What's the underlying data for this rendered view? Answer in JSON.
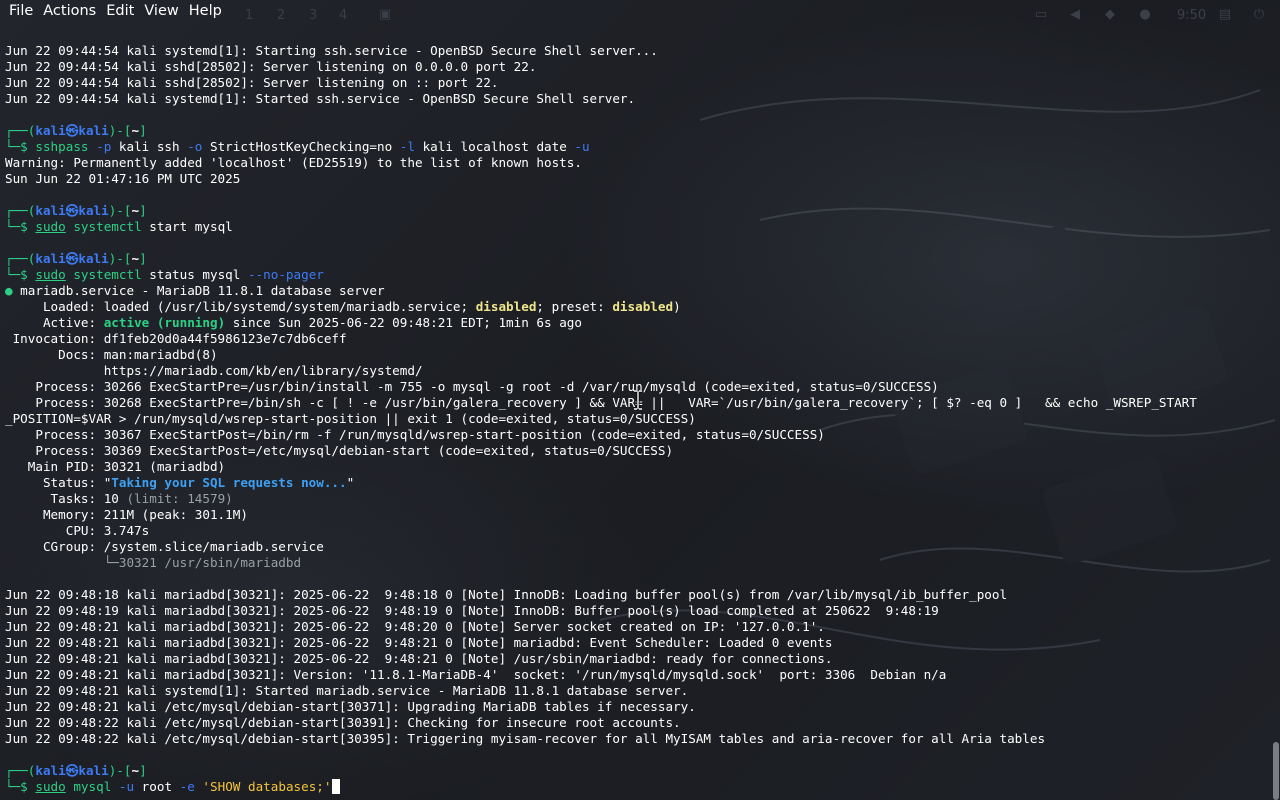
{
  "menubar": {
    "items": [
      "File",
      "Actions",
      "Edit",
      "View",
      "Help"
    ]
  },
  "panel": {
    "workspaces": [
      "1",
      "2",
      "3",
      "4"
    ],
    "clock": "9:50"
  },
  "terminal": {
    "lines": [
      [
        {
          "t": "Jun 22 09:44:54 kali systemd[1]: Starting ssh.service - OpenBSD Secure Shell server..."
        }
      ],
      [
        {
          "t": "Jun 22 09:44:54 kali sshd[28502]: Server listening on 0.0.0.0 port 22."
        }
      ],
      [
        {
          "t": "Jun 22 09:44:54 kali sshd[28502]: Server listening on :: port 22."
        }
      ],
      [
        {
          "t": "Jun 22 09:44:54 kali systemd[1]: Started ssh.service - OpenBSD Secure Shell server."
        }
      ],
      [
        {
          "t": ""
        }
      ],
      [
        {
          "t": "┌──(",
          "c": "green"
        },
        {
          "t": "kali㉿kali",
          "c": "bluebold"
        },
        {
          "t": ")-[",
          "c": "green"
        },
        {
          "t": "~",
          "c": "bold"
        },
        {
          "t": "]",
          "c": "green"
        }
      ],
      [
        {
          "t": "└─$ ",
          "c": "green"
        },
        {
          "t": "sshpass",
          "c": "green"
        },
        {
          "t": " -p",
          "c": "blue"
        },
        {
          "t": " kali ssh"
        },
        {
          "t": " -o",
          "c": "blue"
        },
        {
          "t": " StrictHostKeyChecking=no"
        },
        {
          "t": " -l",
          "c": "blue"
        },
        {
          "t": " kali localhost date"
        },
        {
          "t": " -u",
          "c": "blue"
        }
      ],
      [
        {
          "t": "Warning: Permanently added 'localhost' (ED25519) to the list of known hosts."
        }
      ],
      [
        {
          "t": "Sun Jun 22 01:47:16 PM UTC 2025"
        }
      ],
      [
        {
          "t": ""
        }
      ],
      [
        {
          "t": "┌──(",
          "c": "green"
        },
        {
          "t": "kali㉿kali",
          "c": "bluebold"
        },
        {
          "t": ")-[",
          "c": "green"
        },
        {
          "t": "~",
          "c": "bold"
        },
        {
          "t": "]",
          "c": "green"
        }
      ],
      [
        {
          "t": "└─$ ",
          "c": "green"
        },
        {
          "t": "sudo",
          "c": "green under"
        },
        {
          "t": " systemctl",
          "c": "green"
        },
        {
          "t": " start mysql"
        }
      ],
      [
        {
          "t": ""
        }
      ],
      [
        {
          "t": "┌──(",
          "c": "green"
        },
        {
          "t": "kali㉿kali",
          "c": "bluebold"
        },
        {
          "t": ")-[",
          "c": "green"
        },
        {
          "t": "~",
          "c": "bold"
        },
        {
          "t": "]",
          "c": "green"
        }
      ],
      [
        {
          "t": "└─$ ",
          "c": "green"
        },
        {
          "t": "sudo",
          "c": "green under"
        },
        {
          "t": " systemctl",
          "c": "green"
        },
        {
          "t": " status mysql"
        },
        {
          "t": " --no-pager",
          "c": "blue"
        }
      ],
      [
        {
          "t": "●",
          "c": "greenbold"
        },
        {
          "t": " mariadb.service - MariaDB 11.8.1 database server"
        }
      ],
      [
        {
          "t": "     Loaded: loaded (/usr/lib/systemd/system/mariadb.service; "
        },
        {
          "t": "disabled",
          "c": "yellow"
        },
        {
          "t": "; preset: "
        },
        {
          "t": "disabled",
          "c": "yellow"
        },
        {
          "t": ")"
        }
      ],
      [
        {
          "t": "     Active: "
        },
        {
          "t": "active (running)",
          "c": "greenbold"
        },
        {
          "t": " since Sun 2025-06-22 09:48:21 EDT; 1min 6s ago"
        }
      ],
      [
        {
          "t": " Invocation: df1feb20d0a44f5986123e7c7db6ceff"
        }
      ],
      [
        {
          "t": "       Docs: man:mariadbd(8)"
        }
      ],
      [
        {
          "t": "             https://mariadb.com/kb/en/library/systemd/"
        }
      ],
      [
        {
          "t": "    Process: 30266 ExecStartPre=/usr/bin/install -m 755 -o mysql -g root -d /var/run/mysqld (code=exited, status=0/SUCCESS)"
        }
      ],
      [
        {
          "t": "    Process: 30268 ExecStartPre=/bin/sh -c [ ! -e /usr/bin/galera_recovery ] && VAR= ||   VAR=`/usr/bin/galera_recovery`; [ $? -eq 0 ]   && echo _WSREP_START"
        }
      ],
      [
        {
          "t": "_POSITION=$VAR > /run/mysqld/wsrep-start-position || exit 1 (code=exited, status=0/SUCCESS)"
        }
      ],
      [
        {
          "t": "    Process: 30367 ExecStartPost=/bin/rm -f /run/mysqld/wsrep-start-position (code=exited, status=0/SUCCESS)"
        }
      ],
      [
        {
          "t": "    Process: 30369 ExecStartPost=/etc/mysql/debian-start (code=exited, status=0/SUCCESS)"
        }
      ],
      [
        {
          "t": "   Main PID: 30321 (mariadbd)"
        }
      ],
      [
        {
          "t": "     Status: \""
        },
        {
          "t": "Taking your SQL requests now...",
          "c": "status-str"
        },
        {
          "t": "\""
        }
      ],
      [
        {
          "t": "      Tasks: 10 "
        },
        {
          "t": "(limit: 14579)",
          "c": "gray"
        }
      ],
      [
        {
          "t": "     Memory: 211M (peak: 301.1M)"
        }
      ],
      [
        {
          "t": "        CPU: 3.747s"
        }
      ],
      [
        {
          "t": "     CGroup: /system.slice/mariadb.service"
        }
      ],
      [
        {
          "t": "             └─30321 /usr/sbin/mariadbd",
          "c": "gray"
        }
      ],
      [
        {
          "t": ""
        }
      ],
      [
        {
          "t": "Jun 22 09:48:18 kali mariadbd[30321]: 2025-06-22  9:48:18 0 [Note] InnoDB: Loading buffer pool(s) from /var/lib/mysql/ib_buffer_pool"
        }
      ],
      [
        {
          "t": "Jun 22 09:48:19 kali mariadbd[30321]: 2025-06-22  9:48:19 0 [Note] InnoDB: Buffer pool(s) load completed at 250622  9:48:19"
        }
      ],
      [
        {
          "t": "Jun 22 09:48:21 kali mariadbd[30321]: 2025-06-22  9:48:20 0 [Note] Server socket created on IP: '127.0.0.1'."
        }
      ],
      [
        {
          "t": "Jun 22 09:48:21 kali mariadbd[30321]: 2025-06-22  9:48:21 0 [Note] mariadbd: Event Scheduler: Loaded 0 events"
        }
      ],
      [
        {
          "t": "Jun 22 09:48:21 kali mariadbd[30321]: 2025-06-22  9:48:21 0 [Note] /usr/sbin/mariadbd: ready for connections."
        }
      ],
      [
        {
          "t": "Jun 22 09:48:21 kali mariadbd[30321]: Version: '11.8.1-MariaDB-4'  socket: '/run/mysqld/mysqld.sock'  port: 3306  Debian n/a"
        }
      ],
      [
        {
          "t": "Jun 22 09:48:21 kali systemd[1]: Started mariadb.service - MariaDB 11.8.1 database server."
        }
      ],
      [
        {
          "t": "Jun 22 09:48:21 kali /etc/mysql/debian-start[30371]: Upgrading MariaDB tables if necessary."
        }
      ],
      [
        {
          "t": "Jun 22 09:48:22 kali /etc/mysql/debian-start[30391]: Checking for insecure root accounts."
        }
      ],
      [
        {
          "t": "Jun 22 09:48:22 kali /etc/mysql/debian-start[30395]: Triggering myisam-recover for all MyISAM tables and aria-recover for all Aria tables"
        }
      ],
      [
        {
          "t": ""
        }
      ],
      [
        {
          "t": "┌──(",
          "c": "green"
        },
        {
          "t": "kali㉿kali",
          "c": "bluebold"
        },
        {
          "t": ")-[",
          "c": "green"
        },
        {
          "t": "~",
          "c": "bold"
        },
        {
          "t": "]",
          "c": "green"
        }
      ],
      [
        {
          "t": "└─$ ",
          "c": "green"
        },
        {
          "t": "sudo",
          "c": "green under"
        },
        {
          "t": " mysql",
          "c": "green"
        },
        {
          "t": " -u",
          "c": "blue"
        },
        {
          "t": " root"
        },
        {
          "t": " -e",
          "c": "blue"
        },
        {
          "t": " 'SHOW databases;'",
          "c": "sq"
        }
      ]
    ]
  },
  "colors": {
    "background": "#1c1e24",
    "prompt_green": "#2cd186",
    "prompt_blue": "#3d7bf4",
    "warn_yellow": "#f0e68c"
  }
}
